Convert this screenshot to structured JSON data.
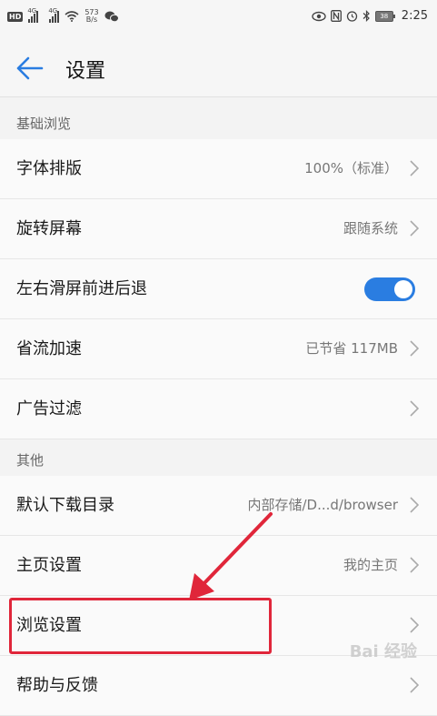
{
  "status_bar": {
    "hd": "HD",
    "signal1": "4G",
    "signal2": "4G",
    "speed_value": "573",
    "speed_unit": "B/s",
    "battery": "38",
    "time": "2:25"
  },
  "header": {
    "title": "设置"
  },
  "sections": {
    "basic": {
      "title": "基础浏览",
      "rows": [
        {
          "label": "字体排版",
          "value": "100%（标准）"
        },
        {
          "label": "旋转屏幕",
          "value": "跟随系统"
        },
        {
          "label": "左右滑屏前进后退",
          "toggle_on": true
        },
        {
          "label": "省流加速",
          "value": "已节省 117MB"
        },
        {
          "label": "广告过滤",
          "value": ""
        }
      ]
    },
    "other": {
      "title": "其他",
      "rows": [
        {
          "label": "默认下载目录",
          "value": "内部存储/D...d/browser"
        },
        {
          "label": "主页设置",
          "value": "我的主页"
        },
        {
          "label": "浏览设置",
          "value": ""
        },
        {
          "label": "帮助与反馈",
          "value": ""
        }
      ]
    }
  },
  "annotation": {
    "color": "#e0263a"
  },
  "watermark": "Bai 经验"
}
